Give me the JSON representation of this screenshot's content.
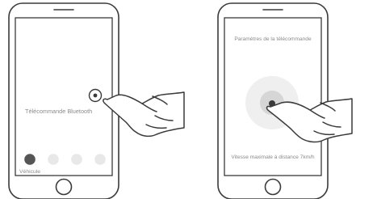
{
  "left_phone": {
    "screen_label": "Télécommande Bluetooth",
    "bottom_label": "Véhicule",
    "tab_dots": [
      "dot-1",
      "dot-2",
      "dot-3",
      "dot-4"
    ],
    "active_dot_index": 0,
    "colors": {
      "active_dot": "#555555",
      "inactive_dot": "#e8e8e8"
    }
  },
  "right_phone": {
    "title": "Paramètres de la télécommande",
    "footer": "Vitesse maximale à distance 7km/h",
    "colors": {
      "joystick_outer": "#efefef",
      "joystick_inner": "#d6d6d6"
    }
  },
  "colors": {
    "outline": "#3a3a3a",
    "text": "#8a8a8a"
  }
}
